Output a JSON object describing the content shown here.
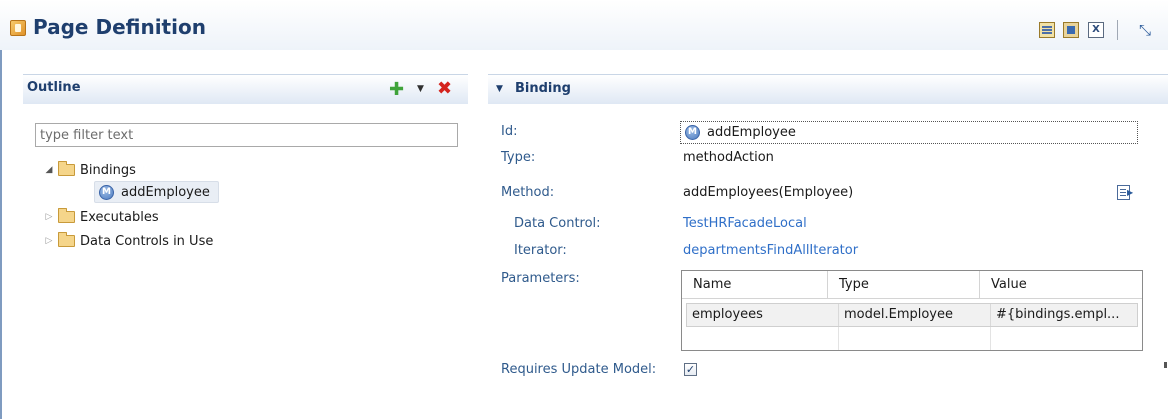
{
  "header": {
    "title": "Page Definition"
  },
  "outline": {
    "title": "Outline",
    "filter_placeholder": "type filter text",
    "tree": [
      {
        "label": "Bindings",
        "expanded": true,
        "children": [
          {
            "label": "addEmployee",
            "selected": true
          }
        ]
      },
      {
        "label": "Executables",
        "expanded": false
      },
      {
        "label": "Data Controls in Use",
        "expanded": false
      }
    ]
  },
  "binding": {
    "section_title": "Binding",
    "id_label": "Id:",
    "id_value": "addEmployee",
    "type_label": "Type:",
    "type_value": "methodAction",
    "method_label": "Method:",
    "method_value": "addEmployees(Employee)",
    "data_control_label": "Data Control:",
    "data_control_value": "TestHRFacadeLocal",
    "iterator_label": "Iterator:",
    "iterator_value": "departmentsFindAllIterator",
    "parameters_label": "Parameters:",
    "parameters": {
      "columns": [
        "Name",
        "Type",
        "Value"
      ],
      "rows": [
        [
          "employees",
          "model.Employee",
          "#{bindings.empl..."
        ]
      ]
    },
    "requires_update_label": "Requires Update Model:",
    "requires_update_checked": true,
    "requires_update_mark": "✓"
  },
  "icons": {
    "method_glyph": "M",
    "x_glyph": "X",
    "plus_glyph": "✚",
    "delete_glyph": "✖",
    "dropdown_glyph": "▼",
    "pin_glyph": "⤡"
  }
}
